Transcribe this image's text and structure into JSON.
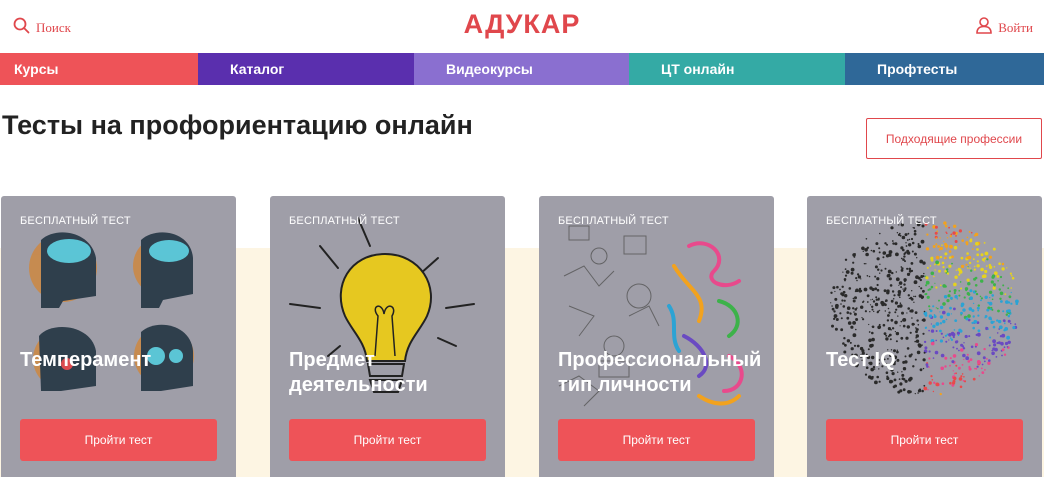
{
  "header": {
    "search_label": "Поиск",
    "logo_text": "АДУКАР",
    "login_label": "Войти",
    "accent_color": "#e0474c"
  },
  "nav": {
    "items": [
      {
        "label": "Курсы",
        "color": "#ee5358"
      },
      {
        "label": "Каталог",
        "color": "#5a2fae"
      },
      {
        "label": "Видеокурсы",
        "color": "#8a6fd0"
      },
      {
        "label": "ЦТ онлайн",
        "color": "#34aaa5"
      },
      {
        "label": "Профтесты",
        "color": "#2f6898"
      }
    ]
  },
  "main": {
    "title": "Тесты на профориентацию онлайн",
    "suitable_button_label": "Подходящие профессии"
  },
  "cards": [
    {
      "badge": "БЕСПЛАТНЫЙ ТЕСТ",
      "title": "Темперамент",
      "button_label": "Пройти тест",
      "image": "heads-icon"
    },
    {
      "badge": "БЕСПЛАТНЫЙ ТЕСТ",
      "title": "Предмет\nдеятельности",
      "button_label": "Пройти тест",
      "image": "lightbulb-icon"
    },
    {
      "badge": "БЕСПЛАТНЫЙ ТЕСТ",
      "title": "Профессиональный\nтип личности",
      "button_label": "Пройти тест",
      "image": "brain-doodle-icon"
    },
    {
      "badge": "БЕСПЛАТНЫЙ ТЕСТ",
      "title": "Тест IQ",
      "button_label": "Пройти тест",
      "image": "dotted-brain-icon"
    }
  ]
}
